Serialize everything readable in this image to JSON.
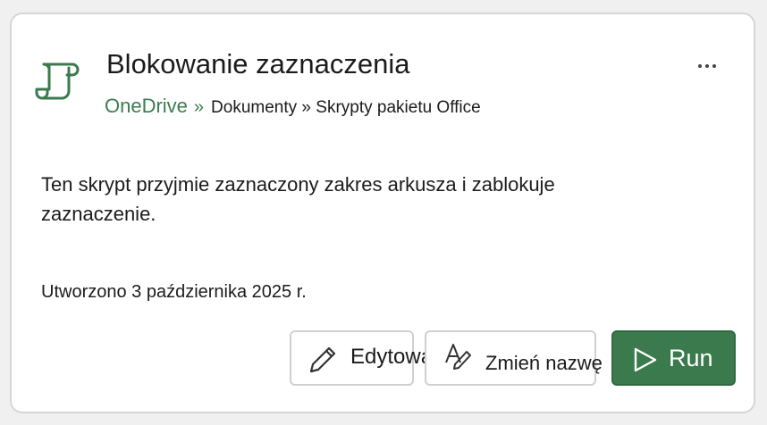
{
  "card": {
    "title": "Blokowanie zaznaczenia",
    "breadcrumb": {
      "root": "OneDrive",
      "separator": "»",
      "rest": "Dokumenty » Skrypty pakietu Office"
    },
    "description": "Ten skrypt przyjmie zaznaczony zakres arkusza i zablokuje zaznaczenie.",
    "created": "Utworzono 3 października 2025 r.",
    "more_icon": "more-horizontal-icon",
    "script_icon": "script-scroll-icon"
  },
  "actions": {
    "edit": {
      "label": "Edytowanie",
      "icon": "pencil-icon"
    },
    "rename": {
      "label": "Zmień nazwę",
      "icon": "rename-icon"
    },
    "run": {
      "label": "Run",
      "icon": "play-icon"
    }
  },
  "colors": {
    "accent": "#3b7a4c",
    "breadcrumb_root": "#3b7c4f",
    "text": "#1b1b1b",
    "card_border": "#d6d6d6",
    "background": "#f0f0f0"
  }
}
